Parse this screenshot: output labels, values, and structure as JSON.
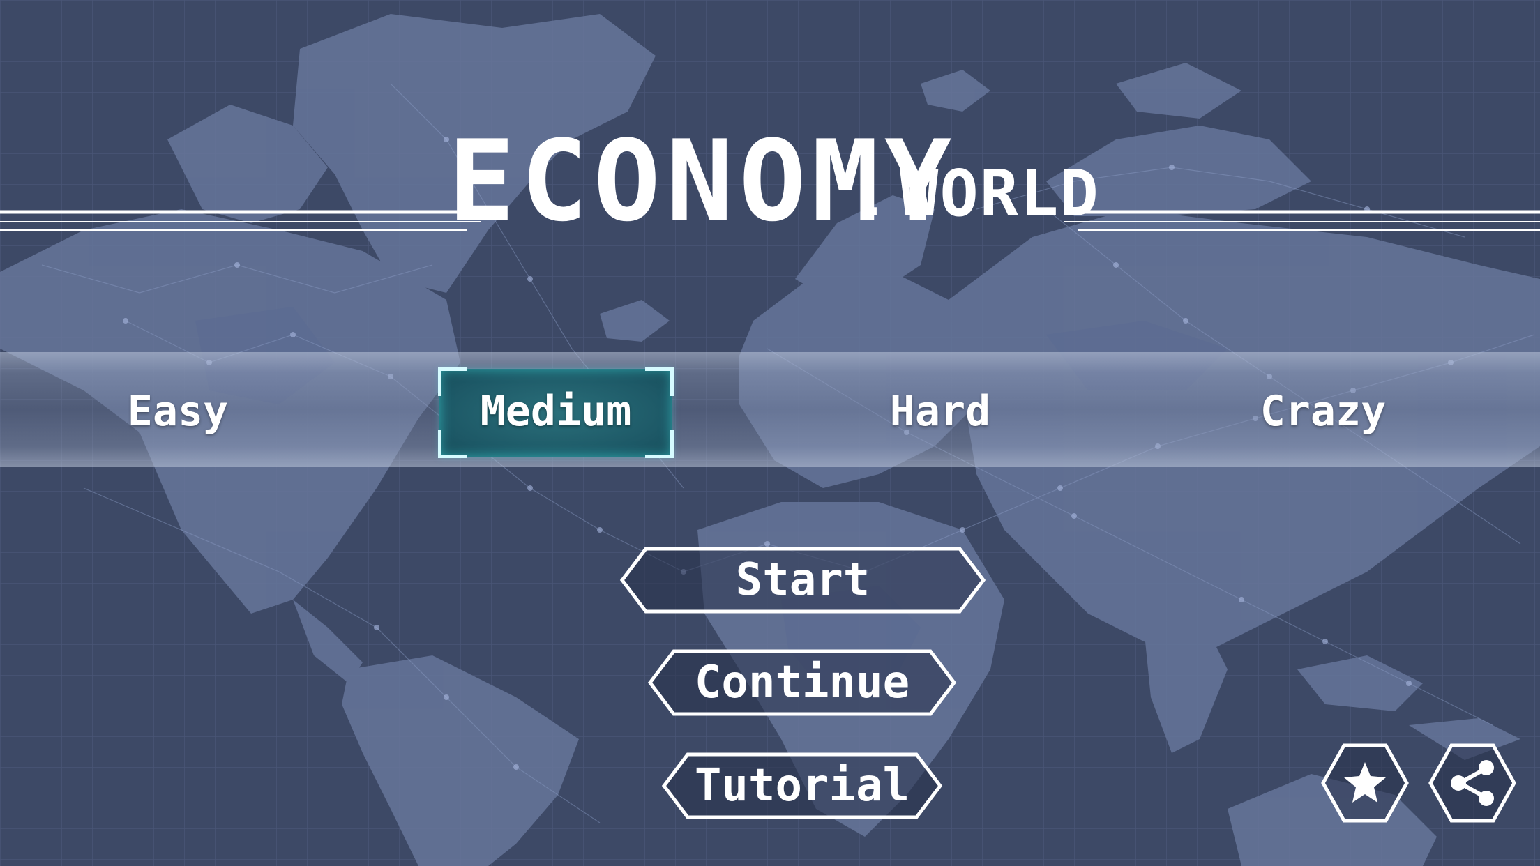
{
  "title": {
    "main": "ECONOMY",
    "dot": ".",
    "sub": "WORLD"
  },
  "difficulty": {
    "options": [
      "Easy",
      "Medium",
      "Hard",
      "Crazy"
    ],
    "selected": "Medium"
  },
  "menu": {
    "start_label": "Start",
    "continue_label": "Continue",
    "tutorial_label": "Tutorial"
  },
  "icons": {
    "rate": "star-icon",
    "share": "share-icon"
  },
  "colors": {
    "background": "#3f4b68",
    "map": "#6d7ca1",
    "selection_accent": "#3fd6d6",
    "text": "#ffffff"
  }
}
